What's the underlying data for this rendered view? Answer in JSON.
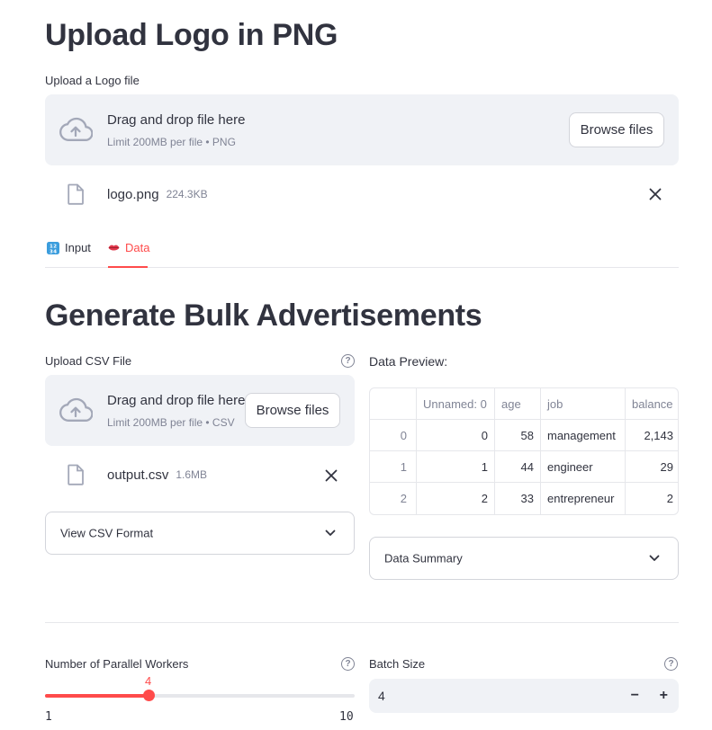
{
  "logo_section": {
    "title": "Upload Logo in PNG",
    "uploader_label": "Upload a Logo file",
    "dropzone_title": "Drag and drop file here",
    "dropzone_limit": "Limit 200MB per file • PNG",
    "browse_label": "Browse files",
    "file_name": "logo.png",
    "file_size": "224.3KB"
  },
  "tabs": [
    {
      "label": "Input",
      "icon": "input-numbers-icon",
      "active": false
    },
    {
      "label": "Data",
      "icon": "lips-icon",
      "active": true
    }
  ],
  "bulk_section": {
    "title": "Generate Bulk Advertisements",
    "csv_label": "Upload CSV File",
    "dropzone_title": "Drag and drop file here",
    "dropzone_limit": "Limit 200MB per file • CSV",
    "browse_label": "Browse files",
    "file_name": "output.csv",
    "file_size": "1.6MB",
    "view_format_label": "View CSV Format",
    "preview_label": "Data Preview:",
    "summary_label": "Data Summary"
  },
  "table": {
    "columns": [
      "",
      "Unnamed: 0",
      "age",
      "job",
      "balance"
    ],
    "rows": [
      [
        "0",
        "0",
        "58",
        "management",
        "2,143"
      ],
      [
        "1",
        "1",
        "44",
        "engineer",
        "29"
      ],
      [
        "2",
        "2",
        "33",
        "entrepreneur",
        "2"
      ]
    ]
  },
  "workers": {
    "label": "Number of Parallel Workers",
    "value": "4",
    "min": "1",
    "max": "10",
    "fraction": 0.3333
  },
  "batch": {
    "label": "Batch Size",
    "value": "4",
    "minus": "−",
    "plus": "+"
  },
  "colors": {
    "accent": "#ff4b4b",
    "panel_bg": "#f0f2f6"
  }
}
